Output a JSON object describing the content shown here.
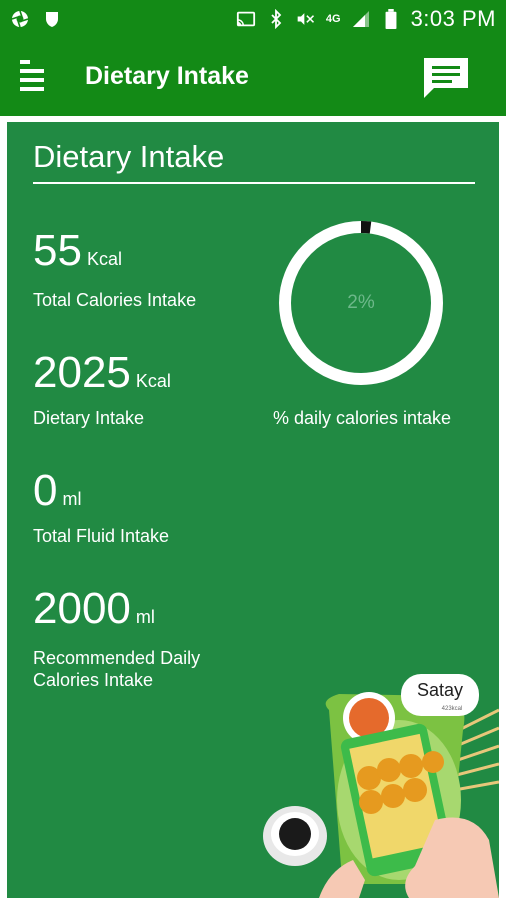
{
  "status_bar": {
    "time": "3:03 PM",
    "network": "4G"
  },
  "app_bar": {
    "title": "Dietary Intake"
  },
  "card": {
    "title": "Dietary Intake",
    "stats": [
      {
        "value": "55",
        "unit": "Kcal",
        "label": "Total Calories Intake"
      },
      {
        "value": "2025",
        "unit": "Kcal",
        "label": "Dietary Intake"
      },
      {
        "value": "0",
        "unit": "ml",
        "label": "Total Fluid Intake"
      },
      {
        "value": "2000",
        "unit": "ml",
        "label_line1": "Recommended Daily",
        "label_line2": "Calories Intake"
      }
    ],
    "progress": {
      "percent_text": "2%",
      "fraction": 0.02,
      "label": "% daily calories intake"
    },
    "illustration": {
      "badge_title": "Satay",
      "badge_sub": "423kcal"
    }
  },
  "colors": {
    "header_green": "#138a16",
    "card_green": "#218a43",
    "ring_track": "#ffffff",
    "ring_fill": "#111111"
  }
}
